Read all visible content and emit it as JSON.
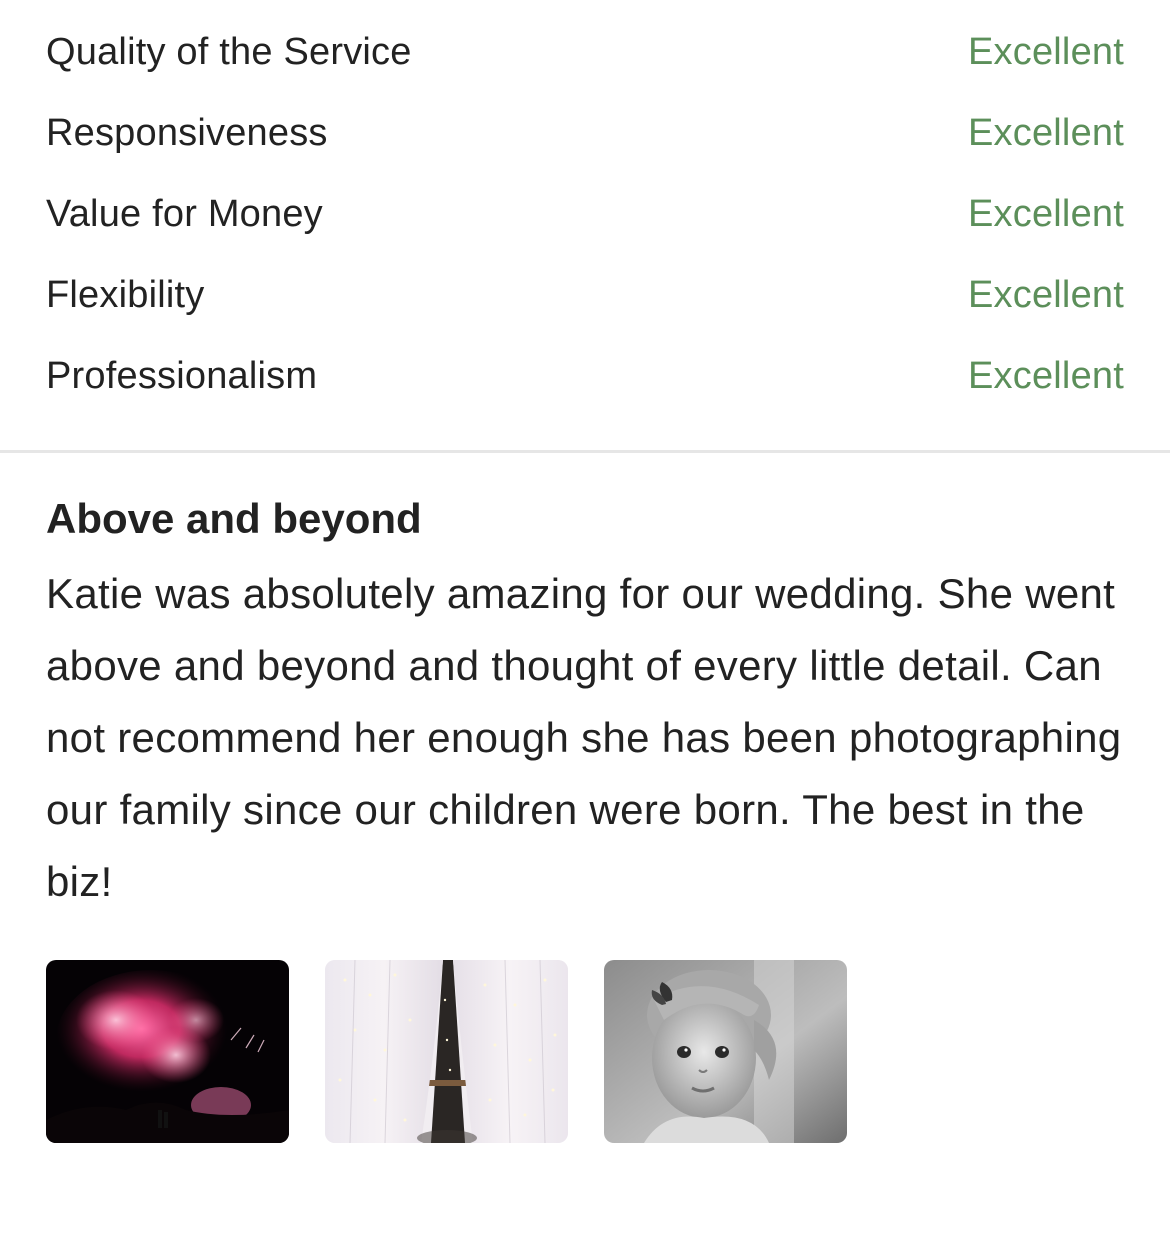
{
  "ratings": [
    {
      "label": "Quality of the Service",
      "value": "Excellent"
    },
    {
      "label": "Responsiveness",
      "value": "Excellent"
    },
    {
      "label": "Value for Money",
      "value": "Excellent"
    },
    {
      "label": "Flexibility",
      "value": "Excellent"
    },
    {
      "label": "Professionalism",
      "value": "Excellent"
    }
  ],
  "review": {
    "title": "Above and beyond",
    "body": "Katie was absolutely amazing for our wedding. She went above and beyond and thought of every little detail. Can not recommend her enough she has been photographing our family since our children were born. The best in the biz!"
  },
  "photos": [
    {
      "icon": "fireworks-photo"
    },
    {
      "icon": "curtain-lights-photo"
    },
    {
      "icon": "child-portrait-photo"
    }
  ],
  "colors": {
    "rating_value": "#5c8f5a",
    "text": "#222222",
    "divider": "#e6e6e6"
  }
}
